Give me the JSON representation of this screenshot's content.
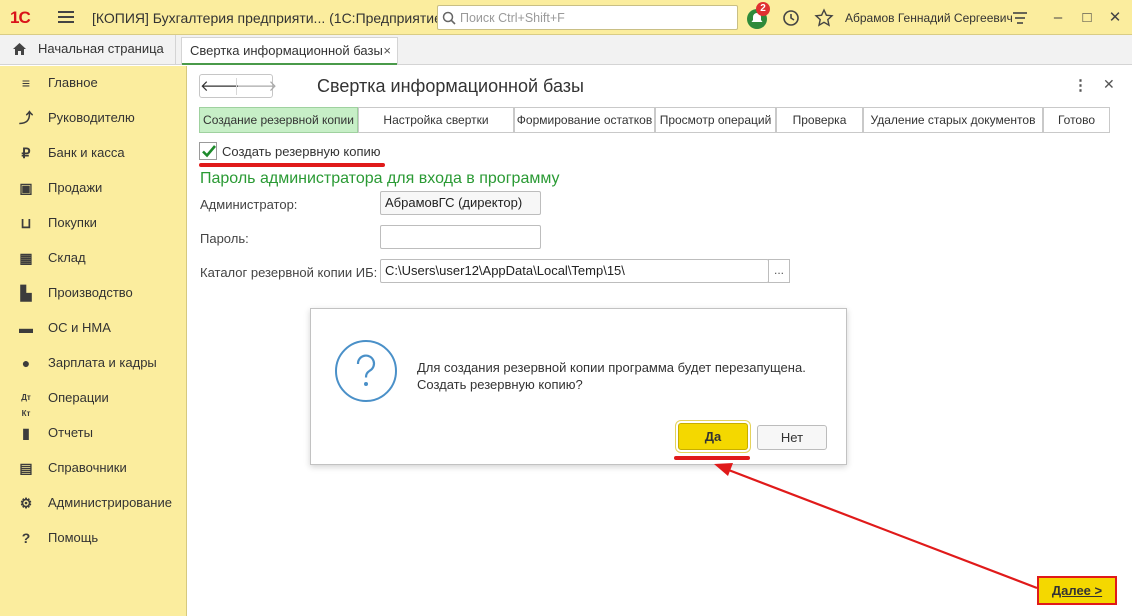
{
  "window": {
    "logo": "1С",
    "title": "[КОПИЯ] Бухгалтерия предприяти... (1С:Предприятие)",
    "search_placeholder": "Поиск Ctrl+Shift+F",
    "notifications_count": "2",
    "user": "Абрамов Геннадий Сергеевич"
  },
  "tabs": {
    "home": "Начальная страница",
    "active": "Свертка информационной базы",
    "close": "×"
  },
  "sidebar": {
    "items": [
      {
        "label": "Главное",
        "icon": "menu-icon"
      },
      {
        "label": "Руководителю",
        "icon": "trend-icon"
      },
      {
        "label": "Банк и касса",
        "icon": "ruble-icon"
      },
      {
        "label": "Продажи",
        "icon": "bag-icon"
      },
      {
        "label": "Покупки",
        "icon": "cart-icon"
      },
      {
        "label": "Склад",
        "icon": "warehouse-icon"
      },
      {
        "label": "Производство",
        "icon": "factory-icon"
      },
      {
        "label": "ОС и НМА",
        "icon": "truck-icon"
      },
      {
        "label": "Зарплата и кадры",
        "icon": "person-icon"
      },
      {
        "label": "Операции",
        "icon": "dt-kt-icon"
      },
      {
        "label": "Отчеты",
        "icon": "bar-chart-icon"
      },
      {
        "label": "Справочники",
        "icon": "books-icon"
      },
      {
        "label": "Администрирование",
        "icon": "gear-icon"
      },
      {
        "label": "Помощь",
        "icon": "question-icon"
      }
    ]
  },
  "main": {
    "title": "Свертка информационной базы",
    "steps": [
      "Создание резервной копии",
      "Настройка свертки",
      "Формирование остатков",
      "Просмотр операций",
      "Проверка",
      "Удаление старых документов",
      "Готово"
    ],
    "active_step": 0,
    "backup_checkbox": {
      "label": "Создать резервную копию",
      "checked": true
    },
    "section_title": "Пароль администратора для входа в программу",
    "fields": {
      "admin_label": "Администратор:",
      "admin_value": "АбрамовГС (директор)",
      "password_label": "Пароль:",
      "password_value": "",
      "backup_dir_label": "Каталог резервной копии ИБ:",
      "backup_dir_value": "C:\\Users\\user12\\AppData\\Local\\Temp\\15\\",
      "browse_label": "..."
    }
  },
  "dialog": {
    "line1": "Для создания резервной копии программа будет перезапущена.",
    "line2": "Создать резервную копию?",
    "yes_label": "Да",
    "no_label": "Нет"
  },
  "footer": {
    "next_label": "Далее >"
  },
  "colors": {
    "accent_yellow": "#f4d800",
    "panel_yellow": "#fbed9e",
    "section_green": "#2a9a34",
    "highlight_red": "#e01a1a"
  }
}
